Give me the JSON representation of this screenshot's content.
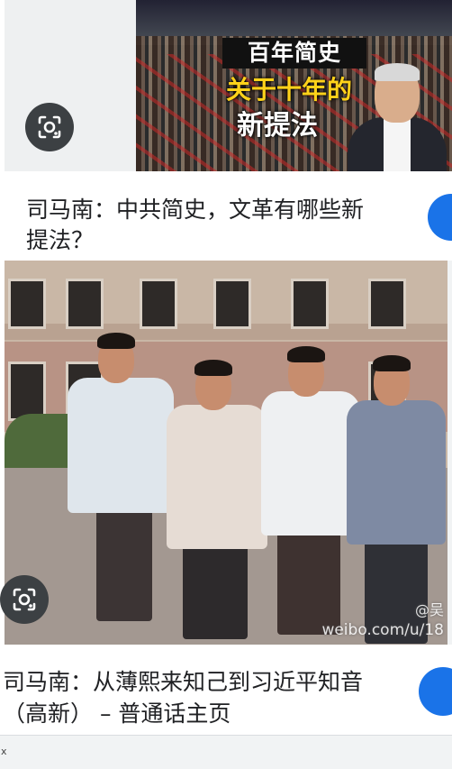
{
  "results": [
    {
      "thumbnail": {
        "title": "百年简史",
        "subtitle_line1": "关于十年的",
        "subtitle_line2": "新提法"
      },
      "title": "司马南：中共简史，文革有哪些新提法？",
      "title_line1": "司马南：中共简史，文革有哪些新",
      "title_line2": "提法？"
    },
    {
      "thumbnail": {
        "watermark_line1": "@吴",
        "watermark_line2": "weibo.com/u/18"
      },
      "title": "司马南：从薄熙来知己到习近平知音（高新） – 普通话主页",
      "title_line1": "司马南：从薄熙来知己到习近平知音",
      "title_line2": "（高新） – 普通话主页"
    }
  ],
  "buttons": {
    "lens_icon": "lens-icon",
    "close_label": "x"
  },
  "colors": {
    "accent": "#1a73e8",
    "lens_bg": "#3c4043"
  }
}
